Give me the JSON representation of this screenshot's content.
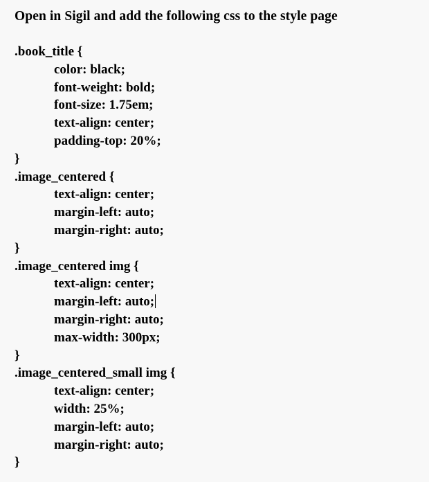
{
  "document": {
    "heading": "Open in Sigil and add the following css to the style page",
    "background_color": "#f8f8f8",
    "text_color": "#000000",
    "caret": {
      "visible": true,
      "after_line_index": 13,
      "glyph": "text-caret"
    },
    "css_lines": [
      {
        "text": ".book_title {",
        "indent": false
      },
      {
        "text": "color: black;",
        "indent": true
      },
      {
        "text": "font-weight: bold;",
        "indent": true
      },
      {
        "text": "font-size: 1.75em;",
        "indent": true
      },
      {
        "text": "text-align: center;",
        "indent": true
      },
      {
        "text": "padding-top: 20%;",
        "indent": true
      },
      {
        "text": "}",
        "indent": false
      },
      {
        "text": ".image_centered {",
        "indent": false
      },
      {
        "text": "text-align: center;",
        "indent": true
      },
      {
        "text": "margin-left: auto;",
        "indent": true
      },
      {
        "text": "margin-right: auto;",
        "indent": true
      },
      {
        "text": "}",
        "indent": false
      },
      {
        "text": ".image_centered img {",
        "indent": false
      },
      {
        "text": "text-align: center;",
        "indent": true
      },
      {
        "text": "margin-left: auto;",
        "indent": true,
        "caret": true
      },
      {
        "text": "margin-right: auto;",
        "indent": true
      },
      {
        "text": "max-width: 300px;",
        "indent": true
      },
      {
        "text": "}",
        "indent": false
      },
      {
        "text": ".image_centered_small img {",
        "indent": false
      },
      {
        "text": "text-align: center;",
        "indent": true
      },
      {
        "text": "width: 25%;",
        "indent": true
      },
      {
        "text": "margin-left: auto;",
        "indent": true
      },
      {
        "text": "margin-right: auto;",
        "indent": true
      },
      {
        "text": "}",
        "indent": false
      }
    ]
  }
}
